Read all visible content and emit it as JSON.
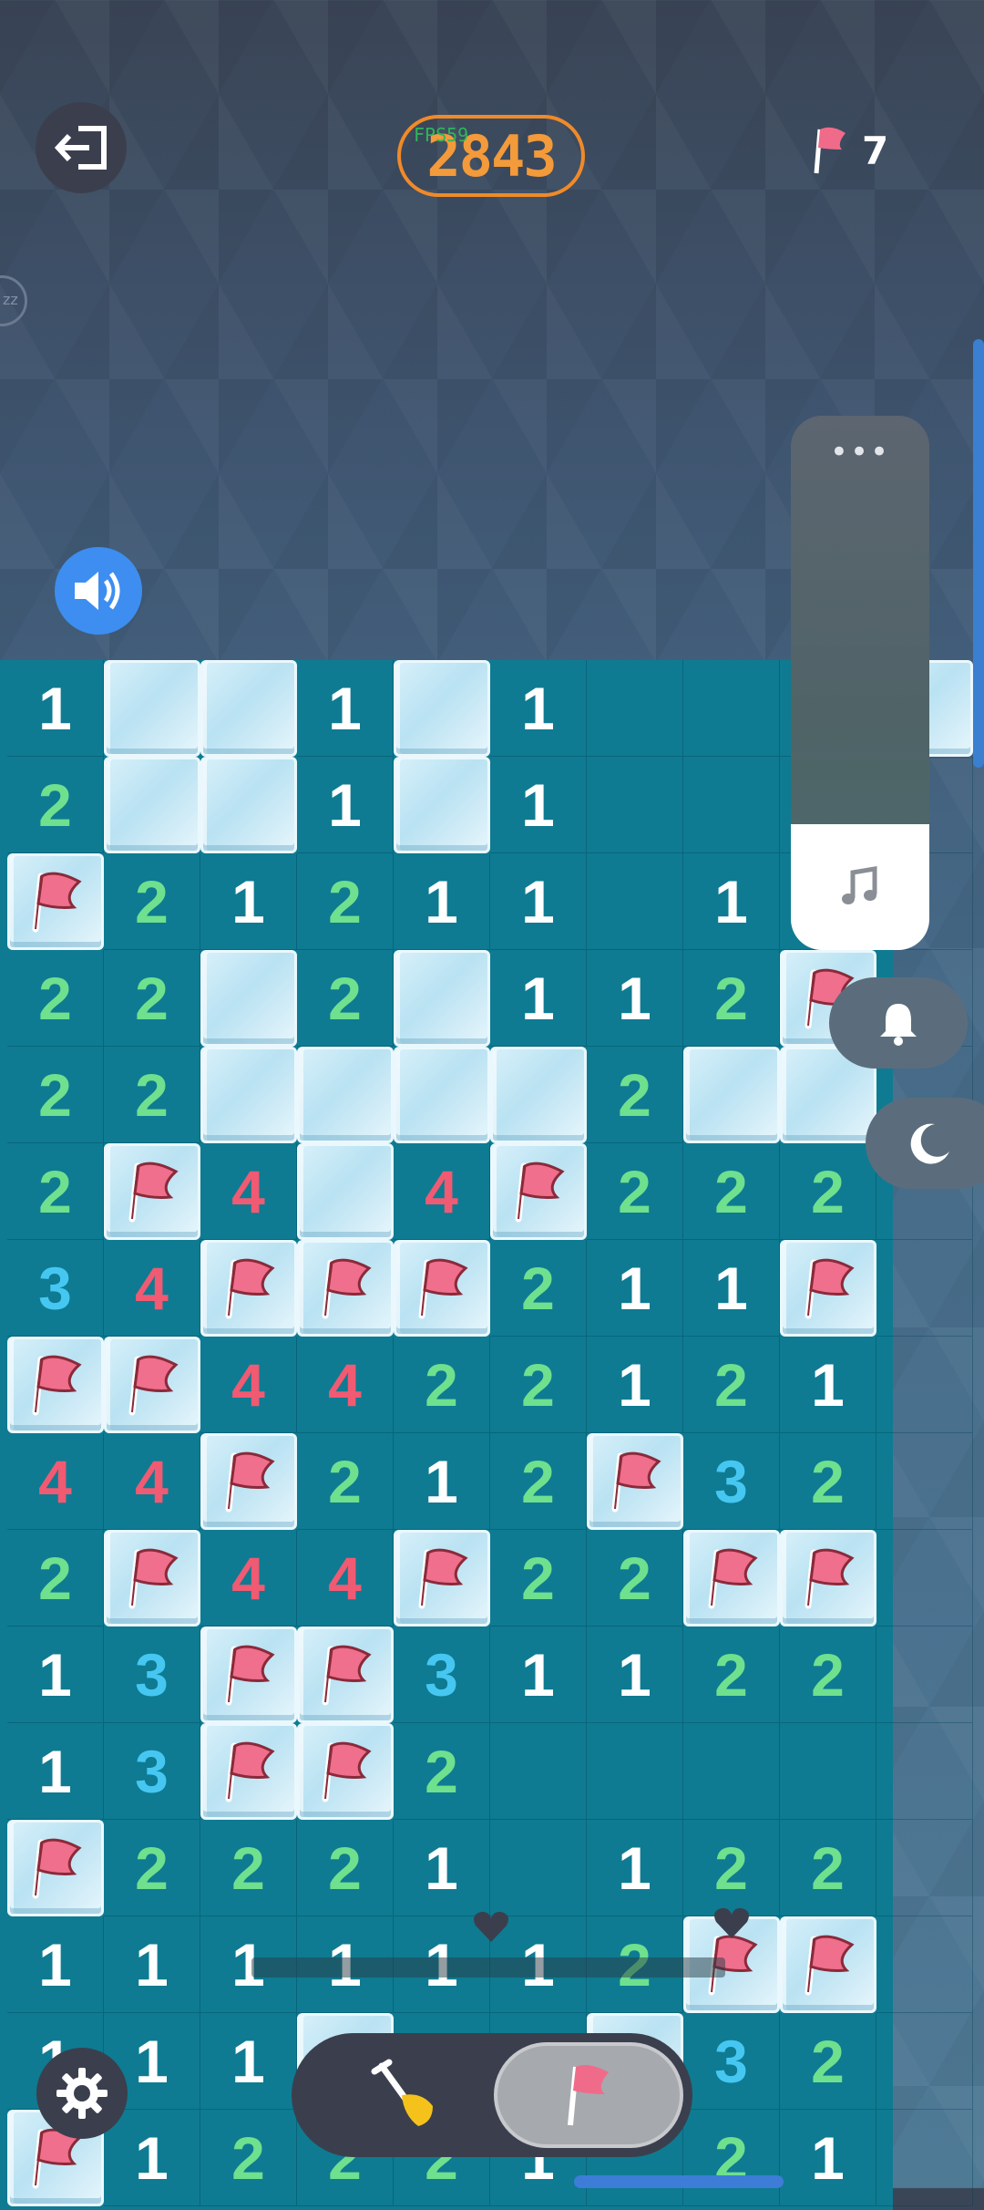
{
  "header": {
    "score": "2843",
    "fps_label": "FPS59",
    "flags_remaining": "7",
    "side_badge": "zz"
  },
  "board": {
    "rows": [
      [
        "1",
        "ice",
        "ice",
        "1",
        "ice",
        "1",
        "",
        "",
        "",
        "ice"
      ],
      [
        "2",
        "ice",
        "ice",
        "1",
        "ice",
        "1",
        "",
        "",
        "",
        ""
      ],
      [
        "F",
        "2",
        "1",
        "2",
        "1",
        "1",
        "",
        "1",
        "",
        ""
      ],
      [
        "2",
        "2",
        "ice",
        "2",
        "ice",
        "1",
        "1",
        "2",
        "F",
        ""
      ],
      [
        "2",
        "2",
        "ice",
        "ice",
        "ice",
        "ice",
        "2",
        "ice",
        "ice",
        ""
      ],
      [
        "2",
        "F",
        "4",
        "ice",
        "4",
        "F",
        "2",
        "2",
        "2",
        ""
      ],
      [
        "3",
        "4",
        "F",
        "F",
        "F",
        "2",
        "1",
        "1",
        "F",
        ""
      ],
      [
        "F",
        "F",
        "4",
        "4",
        "2",
        "2",
        "1",
        "2",
        "1",
        ""
      ],
      [
        "4",
        "4",
        "F",
        "2",
        "1",
        "2",
        "F",
        "3",
        "2",
        ""
      ],
      [
        "2",
        "F",
        "4",
        "4",
        "F",
        "2",
        "2",
        "F",
        "F",
        ""
      ],
      [
        "1",
        "3",
        "F",
        "F",
        "3",
        "1",
        "1",
        "2",
        "2",
        ""
      ],
      [
        "1",
        "3",
        "F",
        "F",
        "2",
        "",
        "",
        "",
        "",
        " "
      ],
      [
        "F",
        "2",
        "2",
        "2",
        "1",
        "",
        "1",
        "2",
        "2",
        ""
      ],
      [
        "1",
        "1",
        "1",
        "1",
        "1",
        "1",
        "2",
        "F",
        "F",
        ""
      ],
      [
        "1",
        "1",
        "1",
        "ice",
        "",
        "",
        "ice",
        "3",
        "2",
        ""
      ],
      [
        "F",
        "1",
        "2",
        "2",
        "2",
        "1",
        "",
        "2",
        "1",
        ""
      ]
    ]
  },
  "media_panel": {
    "dots": "•••",
    "icon": "music-note-icon"
  },
  "side_buttons": {
    "bell": "bell-icon",
    "moon": "moon-icon"
  },
  "toolbar": {
    "dig_icon": "shovel-icon",
    "flag_icon": "flag-icon",
    "selected": "flag"
  },
  "colors": {
    "board": "#0e7b92",
    "one": "#ffffff",
    "two": "#6fe08e",
    "three": "#46c7f2",
    "four": "#f05a72",
    "score_accent": "#f08a28",
    "sound_button": "#3d8ef0"
  }
}
